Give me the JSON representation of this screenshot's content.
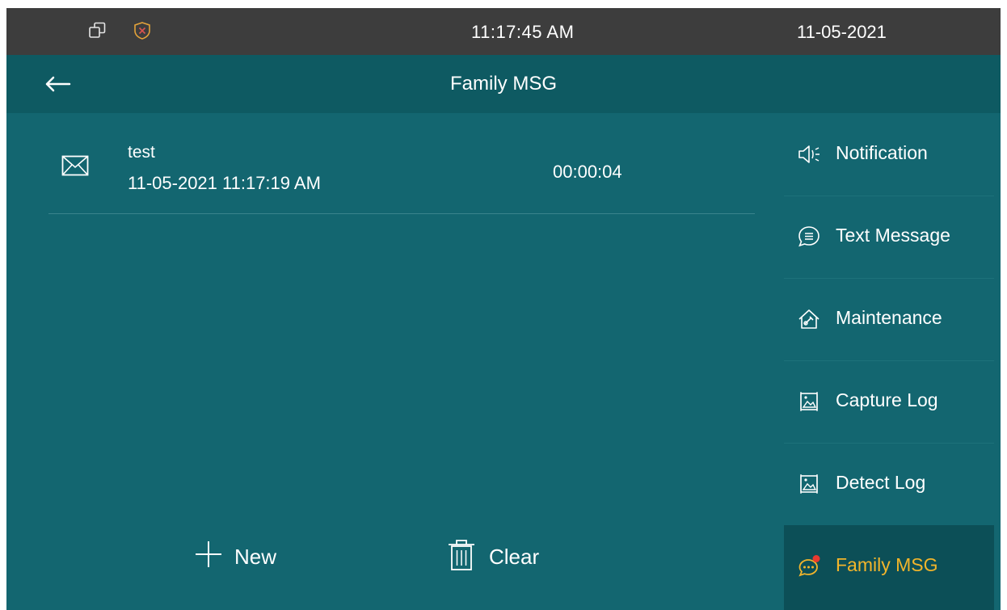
{
  "status_bar": {
    "time": "11:17:45    AM",
    "date": "11-05-2021"
  },
  "header": {
    "title": "Family MSG"
  },
  "messages": [
    {
      "name": "test",
      "datetime": "11-05-2021 11:17:19 AM",
      "duration": "00:00:04"
    }
  ],
  "actions": {
    "new_label": "New",
    "clear_label": "Clear"
  },
  "sidebar": {
    "items": [
      {
        "label": "Notification",
        "icon": "speaker-icon"
      },
      {
        "label": "Text Message",
        "icon": "chat-bubble-icon"
      },
      {
        "label": "Maintenance",
        "icon": "house-tools-icon"
      },
      {
        "label": "Capture Log",
        "icon": "image-log-icon"
      },
      {
        "label": "Detect Log",
        "icon": "image-log-icon"
      },
      {
        "label": "Family MSG",
        "icon": "chat-dots-icon",
        "active": true,
        "has_badge": true
      }
    ]
  },
  "colors": {
    "background": "#136670",
    "title_bar": "#0e5a62",
    "status_bar": "#3d3d3d",
    "active_accent": "#f2b52b",
    "badge": "#e8392f"
  }
}
